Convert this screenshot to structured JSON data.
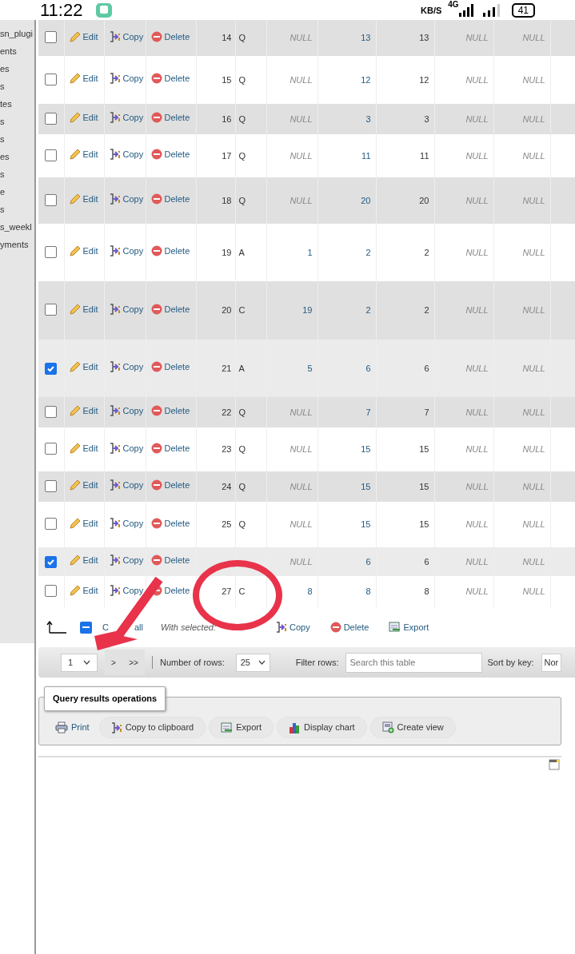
{
  "status_bar": {
    "time": "11:22",
    "speed_unit": "KB/S",
    "network": "4G",
    "battery": "41"
  },
  "sidebar": {
    "items": [
      "sn_plugi",
      "ents",
      "es",
      "s",
      "tes",
      "s",
      "s",
      "es",
      "s",
      "e",
      "s",
      "s_weekl",
      "yments"
    ]
  },
  "rows": [
    {
      "id": "14",
      "type": "Q",
      "checked": false,
      "actions": [
        "Edit",
        "Copy",
        "Delete"
      ],
      "cells": [
        {
          "text": "NULL",
          "kind": "null"
        },
        {
          "text": "13",
          "kind": "link"
        },
        {
          "text": "13",
          "kind": "plain"
        },
        {
          "text": "NULL",
          "kind": "null"
        },
        {
          "text": "NULL",
          "kind": "null"
        }
      ]
    },
    {
      "id": "15",
      "type": "Q",
      "checked": false,
      "actions": [
        "Edit",
        "Copy",
        "Delete"
      ],
      "cells": [
        {
          "text": "NULL",
          "kind": "null"
        },
        {
          "text": "12",
          "kind": "link"
        },
        {
          "text": "12",
          "kind": "plain"
        },
        {
          "text": "NULL",
          "kind": "null"
        },
        {
          "text": "NULL",
          "kind": "null"
        }
      ]
    },
    {
      "id": "16",
      "type": "Q",
      "checked": false,
      "actions": [
        "Edit",
        "Copy",
        "Delete"
      ],
      "cells": [
        {
          "text": "NULL",
          "kind": "null"
        },
        {
          "text": "3",
          "kind": "link"
        },
        {
          "text": "3",
          "kind": "plain"
        },
        {
          "text": "NULL",
          "kind": "null"
        },
        {
          "text": "NULL",
          "kind": "null"
        }
      ]
    },
    {
      "id": "17",
      "type": "Q",
      "checked": false,
      "actions": [
        "Edit",
        "Copy",
        "Delete"
      ],
      "cells": [
        {
          "text": "NULL",
          "kind": "null"
        },
        {
          "text": "11",
          "kind": "link"
        },
        {
          "text": "11",
          "kind": "plain"
        },
        {
          "text": "NULL",
          "kind": "null"
        },
        {
          "text": "NULL",
          "kind": "null"
        }
      ]
    },
    {
      "id": "18",
      "type": "Q",
      "checked": false,
      "actions": [
        "Edit",
        "Copy",
        "Delete"
      ],
      "cells": [
        {
          "text": "NULL",
          "kind": "null"
        },
        {
          "text": "20",
          "kind": "link"
        },
        {
          "text": "20",
          "kind": "plain"
        },
        {
          "text": "NULL",
          "kind": "null"
        },
        {
          "text": "NULL",
          "kind": "null"
        }
      ]
    },
    {
      "id": "19",
      "type": "A",
      "checked": false,
      "actions": [
        "Edit",
        "Copy",
        "Delete"
      ],
      "cells": [
        {
          "text": "1",
          "kind": "link"
        },
        {
          "text": "2",
          "kind": "link"
        },
        {
          "text": "2",
          "kind": "plain"
        },
        {
          "text": "NULL",
          "kind": "null"
        },
        {
          "text": "NULL",
          "kind": "null"
        }
      ]
    },
    {
      "id": "20",
      "type": "C",
      "checked": false,
      "actions": [
        "Edit",
        "Copy",
        "Delete"
      ],
      "cells": [
        {
          "text": "19",
          "kind": "link"
        },
        {
          "text": "2",
          "kind": "link"
        },
        {
          "text": "2",
          "kind": "plain"
        },
        {
          "text": "NULL",
          "kind": "null"
        },
        {
          "text": "NULL",
          "kind": "null"
        }
      ]
    },
    {
      "id": "21",
      "type": "A",
      "checked": true,
      "actions": [
        "Edit",
        "Copy",
        "Delete"
      ],
      "cells": [
        {
          "text": "5",
          "kind": "link"
        },
        {
          "text": "6",
          "kind": "link"
        },
        {
          "text": "6",
          "kind": "plain"
        },
        {
          "text": "NULL",
          "kind": "null"
        },
        {
          "text": "NULL",
          "kind": "null"
        }
      ]
    },
    {
      "id": "22",
      "type": "Q",
      "checked": false,
      "actions": [
        "Edit",
        "Copy",
        "Delete"
      ],
      "cells": [
        {
          "text": "NULL",
          "kind": "null"
        },
        {
          "text": "7",
          "kind": "link"
        },
        {
          "text": "7",
          "kind": "plain"
        },
        {
          "text": "NULL",
          "kind": "null"
        },
        {
          "text": "NULL",
          "kind": "null"
        }
      ]
    },
    {
      "id": "23",
      "type": "Q",
      "checked": false,
      "actions": [
        "Edit",
        "Copy",
        "Delete"
      ],
      "cells": [
        {
          "text": "NULL",
          "kind": "null"
        },
        {
          "text": "15",
          "kind": "link"
        },
        {
          "text": "15",
          "kind": "plain"
        },
        {
          "text": "NULL",
          "kind": "null"
        },
        {
          "text": "NULL",
          "kind": "null"
        }
      ]
    },
    {
      "id": "24",
      "type": "Q",
      "checked": false,
      "actions": [
        "Edit",
        "Copy",
        "Delete"
      ],
      "cells": [
        {
          "text": "NULL",
          "kind": "null"
        },
        {
          "text": "15",
          "kind": "link"
        },
        {
          "text": "15",
          "kind": "plain"
        },
        {
          "text": "NULL",
          "kind": "null"
        },
        {
          "text": "NULL",
          "kind": "null"
        }
      ]
    },
    {
      "id": "25",
      "type": "Q",
      "checked": false,
      "actions": [
        "Edit",
        "Copy",
        "Delete"
      ],
      "cells": [
        {
          "text": "NULL",
          "kind": "null"
        },
        {
          "text": "15",
          "kind": "link"
        },
        {
          "text": "15",
          "kind": "plain"
        },
        {
          "text": "NULL",
          "kind": "null"
        },
        {
          "text": "NULL",
          "kind": "null"
        }
      ]
    },
    {
      "checked": true,
      "actions": [
        "Edit",
        "Copy",
        "Delete"
      ],
      "cells": [
        {
          "text": "NULL",
          "kind": "null"
        },
        {
          "text": "6",
          "kind": "link"
        },
        {
          "text": "6",
          "kind": "plain"
        },
        {
          "text": "NULL",
          "kind": "null"
        },
        {
          "text": "NULL",
          "kind": "null"
        }
      ]
    },
    {
      "id": "27",
      "type": "C",
      "checked": false,
      "actions": [
        "Edit",
        "Copy",
        "Delete"
      ],
      "cells": [
        {
          "text": "8",
          "kind": "link"
        },
        {
          "text": "8",
          "kind": "link"
        },
        {
          "text": "8",
          "kind": "plain"
        },
        {
          "text": "NULL",
          "kind": "null"
        },
        {
          "text": "NULL",
          "kind": "null"
        }
      ]
    }
  ],
  "bulk_actions": {
    "check_all_indeterminate": true,
    "check_all_parts": [
      "C",
      "all"
    ],
    "with_selected": "With selected:",
    "actions": [
      {
        "label": "Copy",
        "kind": "copy"
      },
      {
        "label": "Delete",
        "kind": "delete"
      },
      {
        "label": "Export",
        "kind": "export"
      }
    ]
  },
  "navigation": {
    "page": "1",
    "next": ">",
    "last": ">>",
    "rows_label": "Number of rows:",
    "rows_value": "25",
    "filter_label": "Filter rows:",
    "filter_placeholder": "Search this table",
    "sort_label": "Sort by key:",
    "sort_value": "Nor"
  },
  "operations": {
    "legend": "Query results operations",
    "buttons": [
      {
        "label": "Print",
        "kind": "print"
      },
      {
        "label": "Copy to clipboard",
        "kind": "copy"
      },
      {
        "label": "Export",
        "kind": "export"
      },
      {
        "label": "Display chart",
        "kind": "chart"
      },
      {
        "label": "Create view",
        "kind": "view"
      }
    ]
  }
}
